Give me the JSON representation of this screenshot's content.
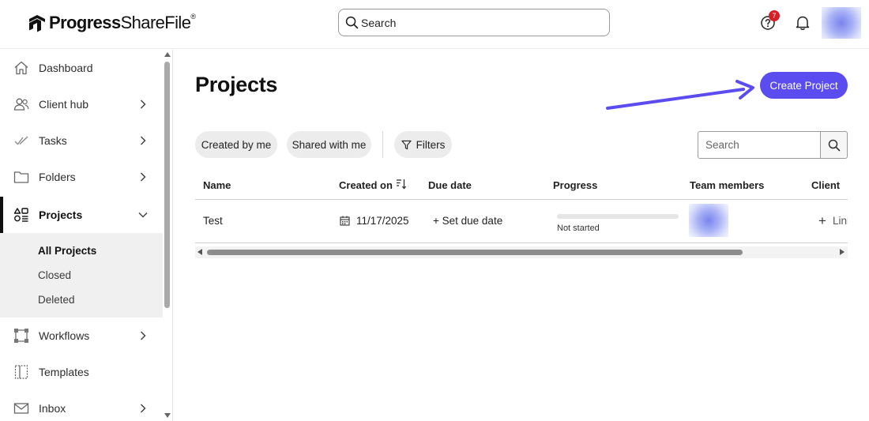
{
  "header": {
    "logo_text_bold": "Progress",
    "logo_text_light": "ShareFile",
    "logo_mark": "®",
    "search_placeholder": "Search",
    "help_badge_count": "7",
    "icons": [
      "help-icon",
      "bell-icon",
      "user-avatar"
    ]
  },
  "sidebar": {
    "items": [
      {
        "label": "Dashboard",
        "icon": "home-icon",
        "has_chevron": false
      },
      {
        "label": "Client hub",
        "icon": "people-icon",
        "has_chevron": true
      },
      {
        "label": "Tasks",
        "icon": "checkmarks-icon",
        "has_chevron": true
      },
      {
        "label": "Folders",
        "icon": "folder-icon",
        "has_chevron": true
      },
      {
        "label": "Projects",
        "icon": "projects-icon",
        "has_chevron": true,
        "expanded": true,
        "active": true
      },
      {
        "label": "Workflows",
        "icon": "workflow-icon",
        "has_chevron": true
      },
      {
        "label": "Templates",
        "icon": "template-icon",
        "has_chevron": false
      },
      {
        "label": "Inbox",
        "icon": "mail-icon",
        "has_chevron": true
      }
    ],
    "subitems": [
      {
        "label": "All Projects",
        "active": true
      },
      {
        "label": "Closed",
        "active": false
      },
      {
        "label": "Deleted",
        "active": false
      }
    ]
  },
  "main": {
    "title": "Projects",
    "create_button": "Create Project",
    "filters": {
      "created_by_me": "Created by me",
      "shared_with_me": "Shared with me",
      "filters_label": "Filters"
    },
    "search_placeholder": "Search",
    "table": {
      "columns": [
        "Name",
        "Created on",
        "Due date",
        "Progress",
        "Team members",
        "Client"
      ],
      "rows": [
        {
          "name": "Test",
          "created_on": "11/17/2025",
          "due_date": "+ Set due date",
          "progress_label": "Not started",
          "progress_value": 0,
          "client_plus": "+",
          "client_link": "Link"
        }
      ]
    }
  },
  "colors": {
    "accent": "#5b4cf0",
    "badge": "#d61f26",
    "sidebar_sub_bg": "#f0f0f0",
    "chip_bg": "#ececec"
  }
}
